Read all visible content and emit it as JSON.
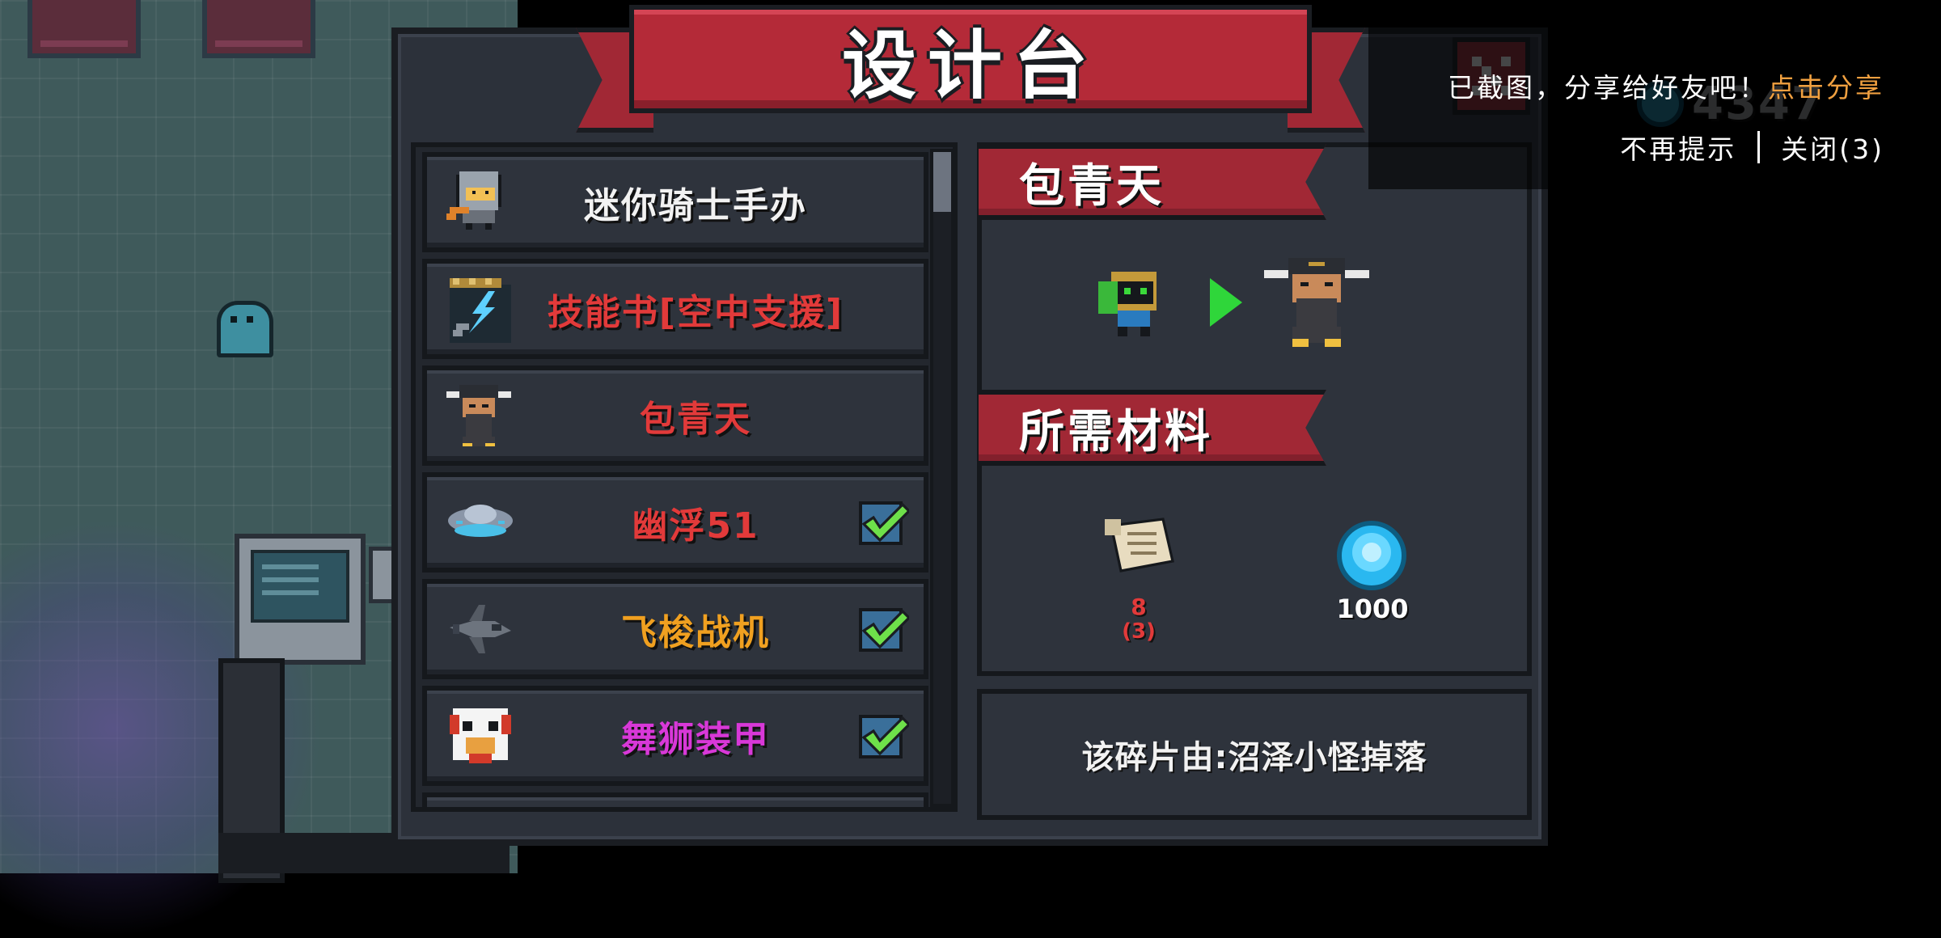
{
  "title": "设计台",
  "items": [
    {
      "label": "迷你骑士手办",
      "color": "#f2f2f2",
      "icon": "mini-knight-figure-icon",
      "checked": false
    },
    {
      "label": "技能书[空中支援]",
      "color": "#e23a3a",
      "icon": "skill-book-icon",
      "checked": false
    },
    {
      "label": "包青天",
      "color": "#e23a3a",
      "icon": "bao-qingtian-icon",
      "checked": false
    },
    {
      "label": "幽浮51",
      "color": "#e23a3a",
      "icon": "ufo-icon",
      "checked": true
    },
    {
      "label": "飞梭战机",
      "color": "#f0a020",
      "icon": "fighter-jet-icon",
      "checked": true
    },
    {
      "label": "舞狮装甲",
      "color": "#d838d8",
      "icon": "lion-dance-armor-icon",
      "checked": true
    }
  ],
  "detail": {
    "name": "包青天",
    "materials_heading": "所需材料",
    "materials": [
      {
        "icon": "blueprint-scroll-icon",
        "count": "8",
        "owned": "(3)",
        "color": "#e23a3a"
      },
      {
        "icon": "gem-coin-icon",
        "count": "1000",
        "color": "#ffffff"
      }
    ],
    "source": "该碎片由:沼泽小怪掉落"
  },
  "currency": {
    "value": "4347"
  },
  "share": {
    "message": "已截图，分享给好友吧！",
    "link": "点击分享",
    "dismiss": "不再提示",
    "close": "关闭(3)"
  }
}
